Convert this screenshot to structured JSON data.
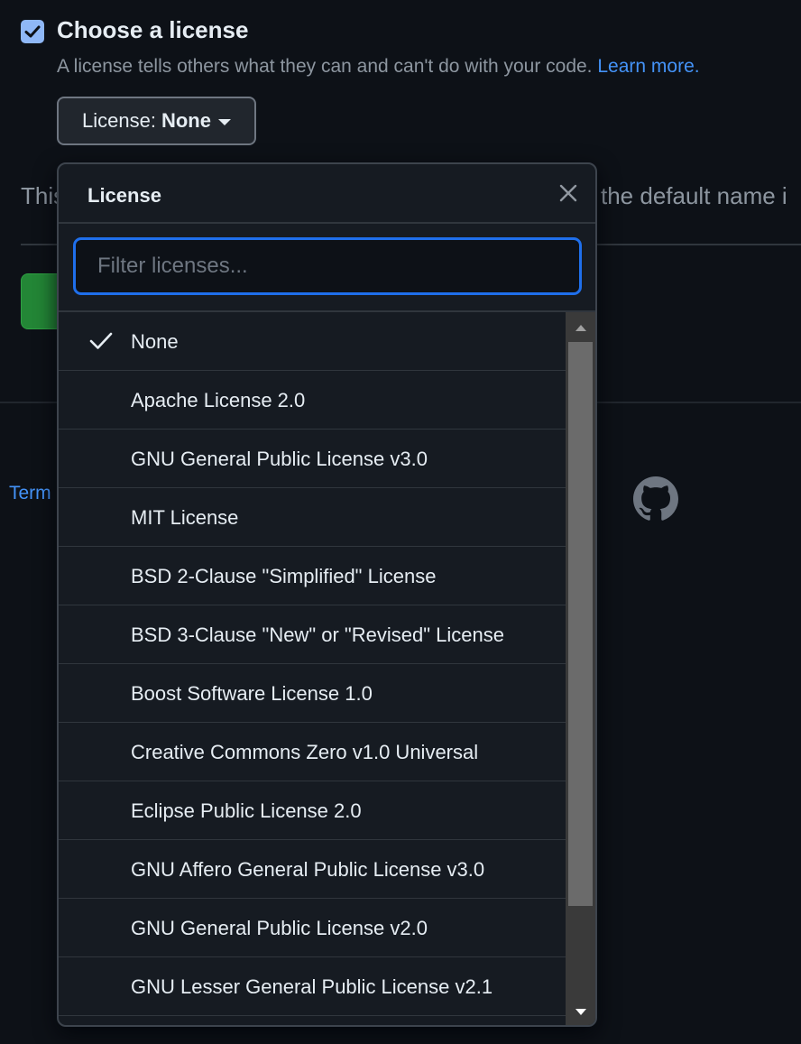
{
  "license_section": {
    "title": "Choose a license",
    "description": "A license tells others what they can and can't do with your code.",
    "learn_more": "Learn more.",
    "checked": true,
    "button_prefix": "License:",
    "button_value": "None"
  },
  "background": {
    "text_left": "This",
    "text_right": "the default name i",
    "footer_link": "Term"
  },
  "dropdown": {
    "title": "License",
    "filter_placeholder": "Filter licenses...",
    "selected": "None",
    "items": [
      {
        "label": "None",
        "selected": true
      },
      {
        "label": "Apache License 2.0",
        "selected": false
      },
      {
        "label": "GNU General Public License v3.0",
        "selected": false
      },
      {
        "label": "MIT License",
        "selected": false
      },
      {
        "label": "BSD 2-Clause \"Simplified\" License",
        "selected": false
      },
      {
        "label": "BSD 3-Clause \"New\" or \"Revised\" License",
        "selected": false
      },
      {
        "label": "Boost Software License 1.0",
        "selected": false
      },
      {
        "label": "Creative Commons Zero v1.0 Universal",
        "selected": false
      },
      {
        "label": "Eclipse Public License 2.0",
        "selected": false
      },
      {
        "label": "GNU Affero General Public License v3.0",
        "selected": false
      },
      {
        "label": "GNU General Public License v2.0",
        "selected": false
      },
      {
        "label": "GNU Lesser General Public License v2.1",
        "selected": false
      }
    ]
  },
  "icons": {
    "checkbox": "checkbox-checked-icon",
    "caret": "caret-down-icon",
    "close": "close-icon",
    "check": "check-icon",
    "github": "github-logo-icon",
    "scroll_up": "scroll-up-arrow-icon",
    "scroll_down": "scroll-down-arrow-icon"
  },
  "colors": {
    "background": "#0d1117",
    "accent_link": "#4493f8",
    "focus_ring": "#1f6feb",
    "checkbox": "#8fb8f7",
    "primary_button": "#238636"
  }
}
